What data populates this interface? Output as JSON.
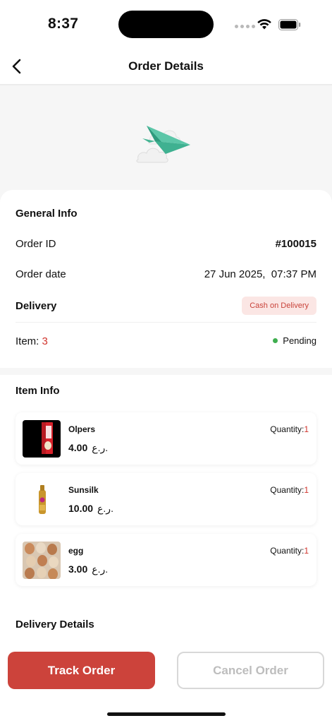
{
  "status_bar": {
    "time": "8:37"
  },
  "nav": {
    "title": "Order Details"
  },
  "general_info": {
    "title": "General Info",
    "order_id_label": "Order ID",
    "order_id_value": "#100015",
    "order_date_label": "Order date",
    "order_date_value": "27 Jun 2025,  07:37 PM",
    "delivery_label": "Delivery",
    "delivery_badge": "Cash on Delivery",
    "item_label": "Item:",
    "item_count": "3",
    "status": "Pending"
  },
  "item_info": {
    "title": "Item Info",
    "quantity_label": "Quantity:",
    "items": [
      {
        "name": "Olpers",
        "price": "4.00",
        "currency": "ر.ع.",
        "quantity": "1"
      },
      {
        "name": "Sunsilk",
        "price": "10.00",
        "currency": "ر.ع.",
        "quantity": "1"
      },
      {
        "name": "egg",
        "price": "3.00",
        "currency": "ر.ع.",
        "quantity": "1"
      }
    ]
  },
  "delivery_details": {
    "title": "Delivery Details"
  },
  "actions": {
    "track_label": "Track Order",
    "cancel_label": "Cancel Order"
  },
  "colors": {
    "accent": "#cc433b",
    "pending": "#3fae4f",
    "badge_bg": "#fbe6e4"
  },
  "icons": [
    "back-icon",
    "wifi-icon",
    "battery-icon",
    "paper-plane-icon"
  ]
}
